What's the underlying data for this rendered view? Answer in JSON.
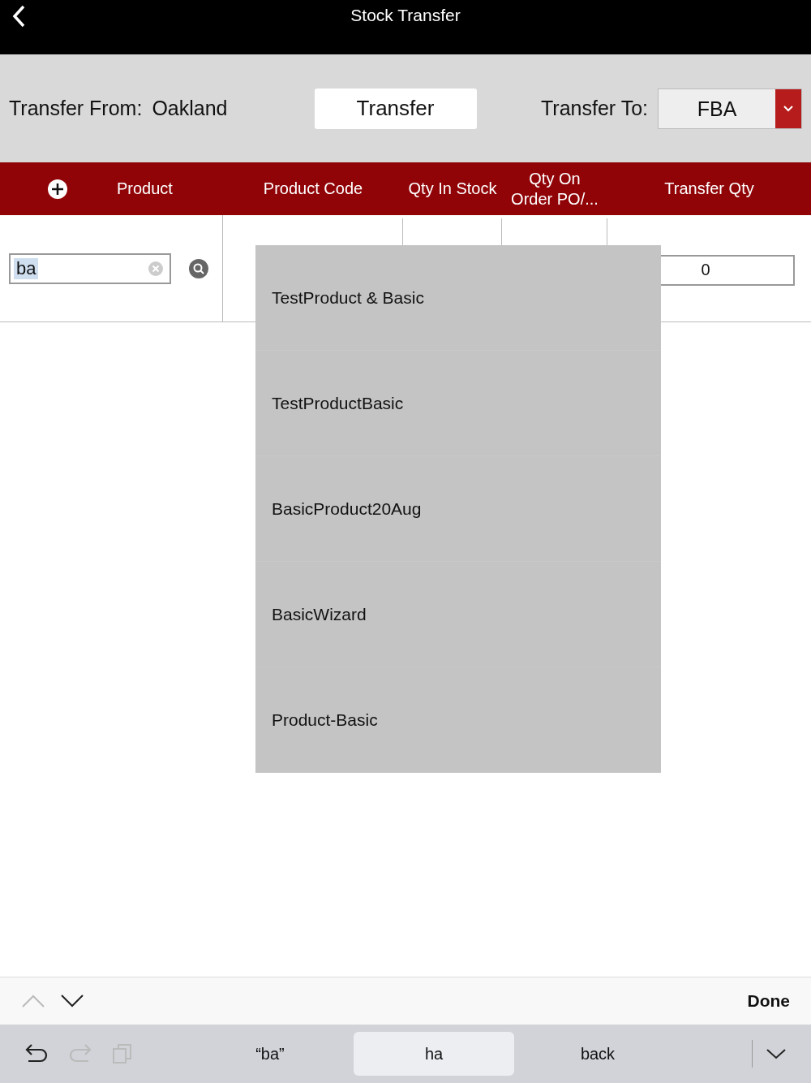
{
  "nav": {
    "title": "Stock Transfer"
  },
  "transfer": {
    "from_label": "Transfer From:",
    "from_value": "Oakland",
    "button": "Transfer",
    "to_label": "Transfer To:",
    "to_value": "FBA"
  },
  "table": {
    "columns": [
      "Product",
      "Product Code",
      "Qty In Stock",
      "Qty On Order PO/...",
      "Transfer Qty"
    ],
    "row": {
      "search": {
        "value": "ba",
        "text_selected": true
      },
      "transfer_qty": "0"
    }
  },
  "suggestions_dropdown": {
    "items": [
      "TestProduct & Basic",
      "TestProductBasic",
      "BasicProduct20Aug",
      "BasicWizard",
      "Product-Basic"
    ]
  },
  "keyboard_toolbar": {
    "previous_enabled": false,
    "next_enabled": true,
    "done": "Done"
  },
  "shortcut_bar": {
    "undo_enabled": true,
    "redo_enabled": false,
    "copy_enabled": false,
    "suggestions": [
      {
        "label": "“ba”",
        "selected": false
      },
      {
        "label": "ha",
        "selected": true
      },
      {
        "label": "back",
        "selected": false
      }
    ]
  }
}
